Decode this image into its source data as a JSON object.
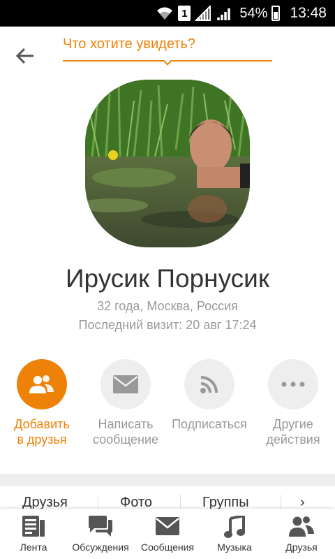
{
  "status_bar": {
    "sim_slot": "1",
    "battery": "54%",
    "time": "13:48",
    "icons": [
      "wifi-icon",
      "sim-icon",
      "signal-icon",
      "battery-icon"
    ]
  },
  "header": {
    "back_icon": "arrow-left-icon",
    "search_prompt": "Что хотите увидеть?"
  },
  "profile": {
    "name": "Ирусик Порнусик",
    "age_location": "32 года, Москва, Россия",
    "last_visit": "Последний визит: 20 авг 17:24"
  },
  "actions": [
    {
      "line1": "Добавить",
      "line2": "в друзья",
      "icon": "add-friend-icon",
      "primary": true
    },
    {
      "line1": "Написать",
      "line2": "сообщение",
      "icon": "envelope-icon",
      "primary": false
    },
    {
      "line1": "Подписаться",
      "line2": "",
      "icon": "rss-icon",
      "primary": false
    },
    {
      "line1": "Другие",
      "line2": "действия",
      "icon": "more-dots-icon",
      "primary": false
    }
  ],
  "tabs": [
    "Друзья",
    "Фото",
    "Группы"
  ],
  "bottom_nav": [
    {
      "label": "Лента",
      "icon": "feed-icon"
    },
    {
      "label": "Обсуждения",
      "icon": "discussions-icon"
    },
    {
      "label": "Сообщения",
      "icon": "messages-icon"
    },
    {
      "label": "Музыка",
      "icon": "music-icon"
    },
    {
      "label": "Друзья",
      "icon": "friends-icon"
    }
  ],
  "colors": {
    "accent": "#ee8208",
    "muted_text": "#999999",
    "icon_gray": "#555555",
    "circle_bg": "#eeeeee"
  }
}
